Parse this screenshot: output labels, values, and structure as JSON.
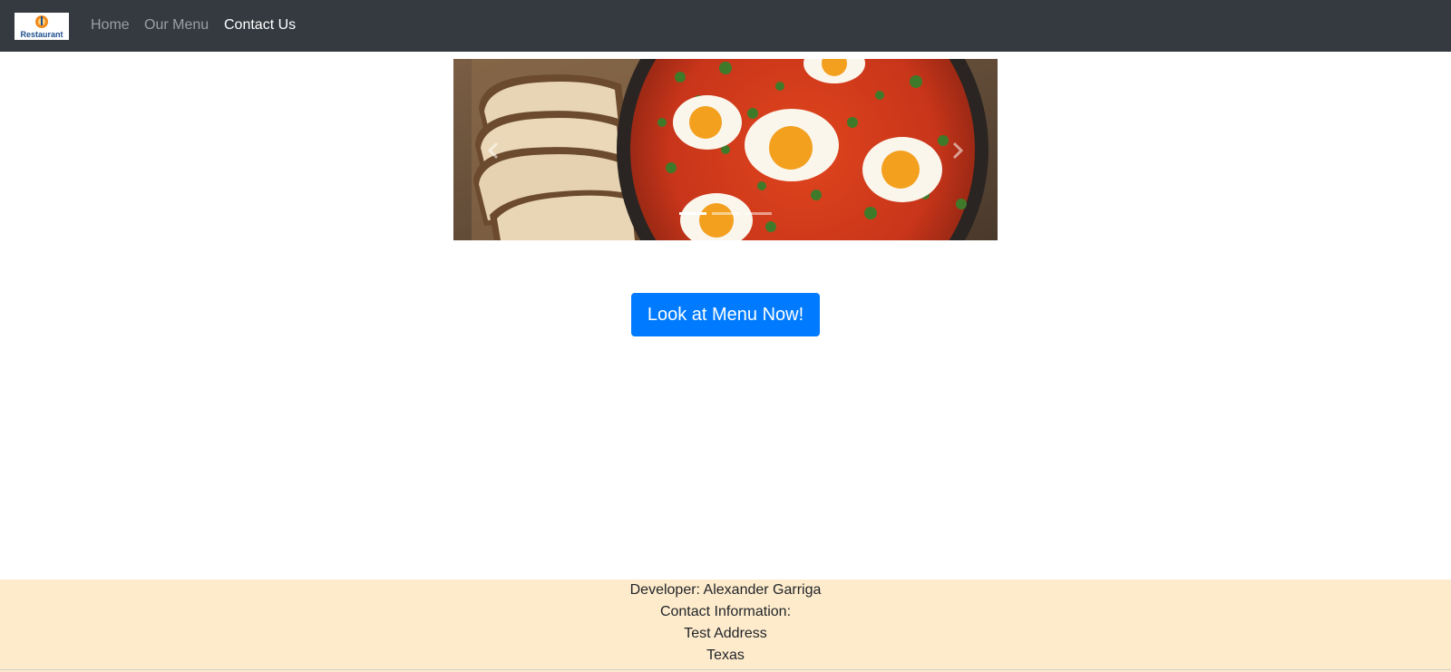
{
  "navbar": {
    "brand": {
      "logo_text": "Restaurant"
    },
    "links": [
      {
        "label": "Home",
        "active": false
      },
      {
        "label": "Our Menu",
        "active": false
      },
      {
        "label": "Contact Us",
        "active": true
      }
    ]
  },
  "carousel": {
    "prev_icon": "chevron-left-icon",
    "next_icon": "chevron-right-icon",
    "slide_count": 3,
    "active_index": 0
  },
  "cta": {
    "label": "Look at Menu Now!"
  },
  "footer": {
    "developer": "Developer: Alexander Garriga",
    "contact_heading": "Contact Information:",
    "address": "Test Address",
    "state": "Texas"
  },
  "colors": {
    "navbar_bg": "#343a40",
    "cta_bg": "#007bff",
    "footer_bg": "#feebcc"
  }
}
